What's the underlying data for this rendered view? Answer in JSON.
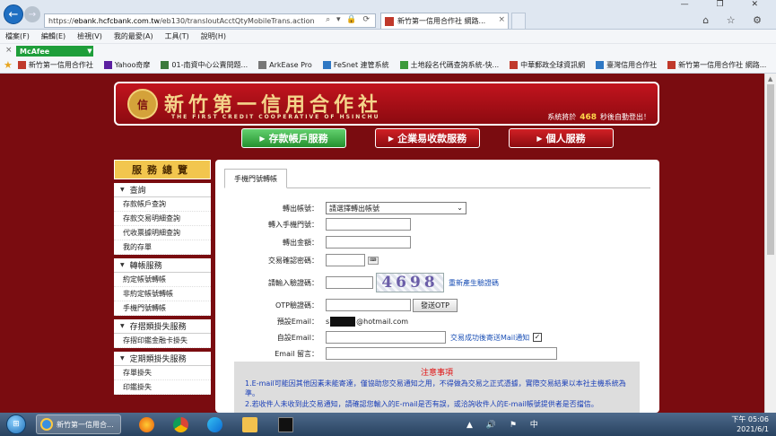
{
  "browser": {
    "url_prefix": "https://",
    "url_host": "ebank.hcfcbank.com.tw",
    "url_path": "/eb130/transloutAcctQtyMobileTrans.action",
    "url_icons": "⌕ ▾ 🔒 ⟳",
    "tab_title": "新竹第一信用合作社 網路...",
    "tab_close": "×",
    "window_controls": "— ❐ ✕",
    "tool_icons": "⌂ ☆ ⚙",
    "menu": [
      "檔案(F)",
      "編輯(E)",
      "檢視(V)",
      "我的最愛(A)",
      "工具(T)",
      "說明(H)"
    ],
    "mcafee_close": "×",
    "mcafee_label": "McAfee",
    "mcafee_arrow": "▼",
    "favorites": [
      {
        "label": "新竹第一信用合作社",
        "color": "#c0392b"
      },
      {
        "label": "Yahoo奇摩",
        "color": "#5b1fa0"
      },
      {
        "label": "01-南資中心公賣問題...",
        "color": "#3c7a3c"
      },
      {
        "label": "ArkEase Pro",
        "color": "#777777"
      },
      {
        "label": "FeSnet 連管系統",
        "color": "#2f78c4"
      },
      {
        "label": "土地殺名代碼查詢系統-快...",
        "color": "#3c9a3c"
      },
      {
        "label": "中華郵政全球資訊網",
        "color": "#c0392b"
      },
      {
        "label": "臺灣信用合作社",
        "color": "#2f78c4"
      },
      {
        "label": "新竹第一信用合作社 網路...",
        "color": "#c0392b"
      }
    ]
  },
  "banner": {
    "logo_glyph": "信",
    "name_zh": "新竹第一信用合作社",
    "name_en": "THE FIRST CREDIT COOPERATIVE OF HSINCHU",
    "timeout_prefix": "系統將於",
    "timeout_seconds": "468",
    "timeout_suffix": "秒後自動登出！"
  },
  "services": {
    "deposit": "存款帳戶服務",
    "collect": "企業易收款服務",
    "personal": "個人服務",
    "arrow": "▶"
  },
  "sidebar": {
    "title": "服務總覽",
    "groups": [
      {
        "head": "查詢",
        "items": [
          "存款帳戶查詢",
          "存款交易明細查詢",
          "代收票據明細查詢",
          "我的存單"
        ]
      },
      {
        "head": "轉帳服務",
        "items": [
          "約定帳號轉帳",
          "非約定帳號轉帳",
          "手機門號轉帳"
        ]
      },
      {
        "head": "存摺類掛失服務",
        "items": [
          "存摺印鑑金融卡掛失"
        ]
      },
      {
        "head": "定期類掛失服務",
        "items": [
          "存單掛失",
          "印鑑掛失"
        ]
      }
    ]
  },
  "form": {
    "tab": "手機門號轉帳",
    "from_account_label": "轉出帳號：",
    "from_account_value": "請選擇轉出帳號",
    "phone_label": "轉入手機門號：",
    "amount_label": "轉出金額：",
    "password_label": "交易確認密碼：",
    "captcha_label": "請輸入驗證碼：",
    "captcha_value": "4698",
    "captcha_refresh": "重新產生驗證碼",
    "otp_label": "OTP驗證碼：",
    "otp_button": "發送OTP",
    "default_email_label": "預設Email：",
    "default_email_start": "s",
    "default_email_domain": "@hotmail.com",
    "custom_email_label": "自設Email：",
    "notify_label": "交易成功後寄送Mail通知",
    "checked_mark": "✓",
    "email_msg_label": "Email 留言：",
    "chevron": "⌄",
    "kbd_glyph": "⌨"
  },
  "notice": {
    "title": "注意事項",
    "line1": "1.E-mail可能因其他因素未能寄達，僅協助您交易通知之用，不得做為交易之正式憑據，實際交易結果以本社主機系統為準。",
    "line2": "2.若收件人未收到此交易通知，請確認您輸入的E-mail是否有誤，或洽詢收件人的E-mail帳號提供者是否擋信。"
  },
  "taskbar": {
    "start_glyph": "⊞",
    "ie_label": "新竹第一信用合...",
    "tray": "▲ 🔊 ⚑ 中",
    "time": "下午 05:06",
    "date": "2021/6/1"
  }
}
